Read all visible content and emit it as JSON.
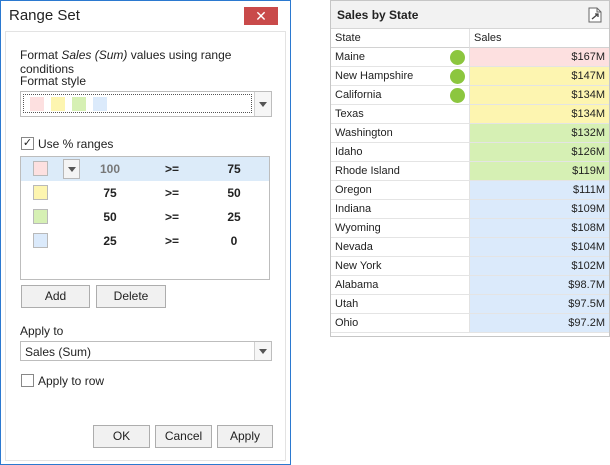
{
  "dialog": {
    "title": "Range Set",
    "close_glyph": "✕",
    "description": "Format Sales (Sum) values using range conditions",
    "format_style_label": "Format style",
    "style_swatches": [
      "#fde0e0",
      "#fdf5b0",
      "#d6f0b4",
      "#dbeafb"
    ],
    "use_percent_label": "Use % ranges",
    "use_percent_checked": true,
    "ranges": [
      {
        "color": "#fde0e0",
        "from": "100",
        "op": ">=",
        "to": "75",
        "selected": true
      },
      {
        "color": "#fdf5b0",
        "from": "75",
        "op": ">=",
        "to": "50",
        "selected": false
      },
      {
        "color": "#d6f0b4",
        "from": "50",
        "op": ">=",
        "to": "25",
        "selected": false
      },
      {
        "color": "#dbeafb",
        "from": "25",
        "op": ">=",
        "to": "0",
        "selected": false
      }
    ],
    "add_label": "Add",
    "delete_label": "Delete",
    "apply_to_label": "Apply to",
    "apply_to_value": "Sales (Sum)",
    "apply_to_row_label": "Apply to row",
    "apply_to_row_checked": false,
    "ok_label": "OK",
    "cancel_label": "Cancel",
    "apply_label": "Apply"
  },
  "grid": {
    "title": "Sales by State",
    "export_icon": "export-icon",
    "col_state": "State",
    "col_sales": "Sales",
    "rows": [
      {
        "state": "Maine",
        "sales": "$167M",
        "bg": "#fde0e0",
        "dot": true
      },
      {
        "state": "New Hampshire",
        "sales": "$147M",
        "bg": "#fdf5b0",
        "dot": true
      },
      {
        "state": "California",
        "sales": "$134M",
        "bg": "#fdf5b0",
        "dot": true
      },
      {
        "state": "Texas",
        "sales": "$134M",
        "bg": "#fdf5b0",
        "dot": false
      },
      {
        "state": "Washington",
        "sales": "$132M",
        "bg": "#d6f0b4",
        "dot": false
      },
      {
        "state": "Idaho",
        "sales": "$126M",
        "bg": "#d6f0b4",
        "dot": false
      },
      {
        "state": "Rhode Island",
        "sales": "$119M",
        "bg": "#d6f0b4",
        "dot": false
      },
      {
        "state": "Oregon",
        "sales": "$111M",
        "bg": "#dbeafb",
        "dot": false
      },
      {
        "state": "Indiana",
        "sales": "$109M",
        "bg": "#dbeafb",
        "dot": false
      },
      {
        "state": "Wyoming",
        "sales": "$108M",
        "bg": "#dbeafb",
        "dot": false
      },
      {
        "state": "Nevada",
        "sales": "$104M",
        "bg": "#dbeafb",
        "dot": false
      },
      {
        "state": "New York",
        "sales": "$102M",
        "bg": "#dbeafb",
        "dot": false
      },
      {
        "state": "Alabama",
        "sales": "$98.7M",
        "bg": "#dbeafb",
        "dot": false
      },
      {
        "state": "Utah",
        "sales": "$97.5M",
        "bg": "#dbeafb",
        "dot": false
      },
      {
        "state": "Ohio",
        "sales": "$97.2M",
        "bg": "#dbeafb",
        "dot": false
      }
    ],
    "dot_color": "#8cc63f"
  }
}
